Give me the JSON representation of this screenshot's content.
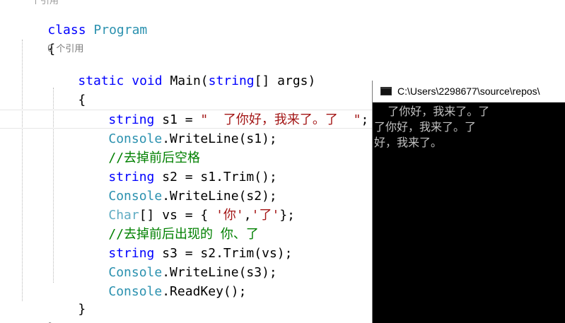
{
  "editor": {
    "codelens_top": "个引用",
    "codelens_main": "0 个引用",
    "lines": {
      "class_kw": "class",
      "class_name": "Program",
      "brace_open_outer": "{",
      "static_kw": "static",
      "void_kw": "void",
      "main_sig_a": "Main(",
      "string_kw_param": "string",
      "main_sig_b": "[] args)",
      "brace_open_inner": "{",
      "l1_type": "string",
      "l1_rest": " s1 = ",
      "l1_str": "\"  了你好，我来了。了  \"",
      "l1_end": ";",
      "l2_cls": "Console",
      "l2_rest": ".WriteLine(s1);",
      "l3_comment": "//去掉前后空格",
      "l4_type": "string",
      "l4_rest": " s2 = s1.Trim();",
      "l5_cls": "Console",
      "l5_rest": ".WriteLine(s2);",
      "l6_type": "Char",
      "l6_rest_a": "[] vs = { ",
      "l6_char1": "'你'",
      "l6_comma": ",",
      "l6_char2": "'了'",
      "l6_rest_b": "};",
      "l7_comment": "//去掉前后出现的 你、了",
      "l8_type": "string",
      "l8_rest": " s3 = s2.Trim(vs);",
      "l9_cls": "Console",
      "l9_rest": ".WriteLine(s3);",
      "l10_cls": "Console",
      "l10_rest": ".ReadKey();",
      "brace_close_inner": "}",
      "brace_close_outer": "}"
    }
  },
  "console": {
    "title": "C:\\Users\\2298677\\source\\repos\\",
    "output": [
      "  了你好，我来了。了",
      "了你好，我来了。了",
      "好，我来了。"
    ]
  },
  "colors": {
    "keyword": "#0000ff",
    "type": "#2b91af",
    "string": "#a31515",
    "comment": "#008000",
    "console_bg": "#000000",
    "console_text": "#c0c0c0"
  }
}
